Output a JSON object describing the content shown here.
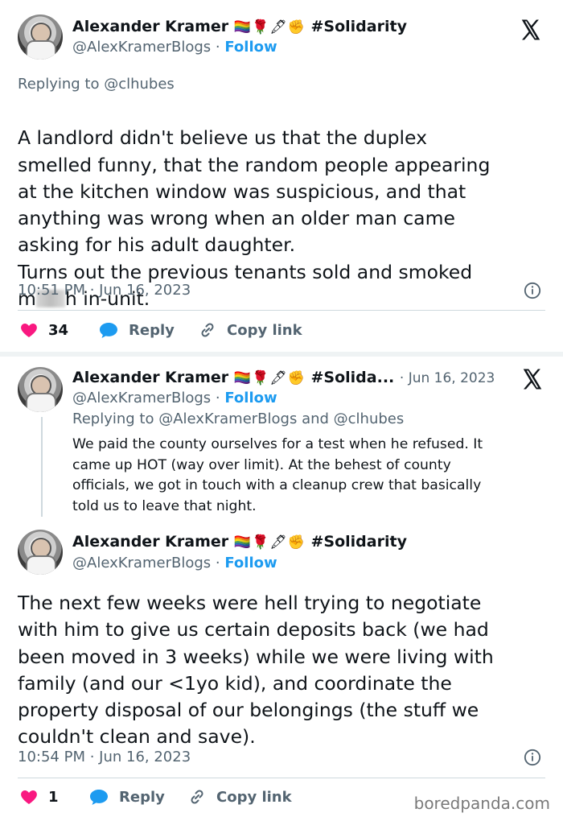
{
  "colors": {
    "like": "#f91880",
    "reply": "#1d9bf0",
    "muted": "#536471",
    "follow": "#1d9bf0"
  },
  "tweet1": {
    "name": "Alexander Kramer",
    "emoji": "🏳️‍🌈🌹🖋✊",
    "hashtag": "#Solidarity",
    "handle": "@AlexKramerBlogs",
    "sep": "·",
    "follow": "Follow",
    "replying_label": "Replying to",
    "replying_to": "@clhubes",
    "text_part1": "A landlord didn't believe us that the duplex\nsmelled funny, that the random people appearing\nat the kitchen window was suspicious, and that\nanything was wrong when an older man came\nasking for his adult daughter.\nTurns out the previous tenants sold and smoked",
    "text_m": "m",
    "text_end": "h in-unit.",
    "time": "10:51 PM · Jun 16, 2023",
    "likes": "34",
    "reply_label": "Reply",
    "copy_label": "Copy link"
  },
  "tweet2": {
    "name": "Alexander Kramer",
    "emoji": "🏳️‍🌈🌹🖋✊",
    "hashtag": "#Solida...",
    "date": "· Jun 16, 2023",
    "handle": "@AlexKramerBlogs",
    "sep": "·",
    "follow": "Follow",
    "replying_label": "Replying to",
    "replying_to": "@AlexKramerBlogs and @clhubes",
    "text": "We paid the county ourselves for a test when he refused. It\ncame up HOT (way over limit). At the behest of county\nofficials, we got in touch with a cleanup crew that basically\ntold us to leave that night."
  },
  "tweet3": {
    "name": "Alexander Kramer",
    "emoji": "🏳️‍🌈🌹🖋✊",
    "hashtag": "#Solidarity",
    "handle": "@AlexKramerBlogs",
    "sep": "·",
    "follow": "Follow",
    "text": "The next few weeks were hell trying to negotiate\nwith him to give us certain deposits back (we had\nbeen moved in 3 weeks) while we were living with\nfamily (and our <1yo kid), and coordinate the\nproperty disposal of our belongings (the stuff we\ncouldn't clean and save).",
    "time": "10:54 PM · Jun 16, 2023",
    "likes": "1",
    "reply_label": "Reply",
    "copy_label": "Copy link"
  },
  "watermark": "boredpanda.com"
}
